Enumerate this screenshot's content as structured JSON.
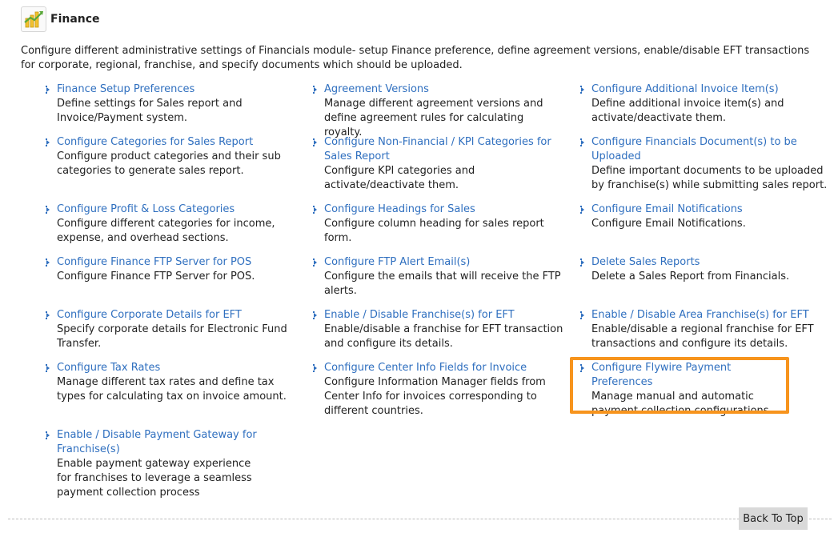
{
  "header": {
    "title": "Finance",
    "icon": "finance-chart-icon"
  },
  "intro": "Configure different administrative settings of Financials module- setup Finance preference, define agreement versions, enable/disable EFT transactions for corporate, regional, franchise, and specify documents which should be uploaded.",
  "items": [
    {
      "title": "Finance Setup Preferences",
      "desc": "Define settings for Sales report and Invoice/Payment system."
    },
    {
      "title": "Agreement Versions",
      "desc": "Manage different agreement versions and define agreement rules for calculating royalty."
    },
    {
      "title": "Configure Additional Invoice Item(s)",
      "desc": "Define additional invoice item(s) and activate/deactivate them."
    },
    {
      "title": "Configure Categories for Sales Report",
      "desc": "Configure product categories and their sub categories to generate sales report."
    },
    {
      "title": "Configure Non-Financial / KPI Categories for Sales Report",
      "desc": "Configure KPI categories and activate/deactivate them."
    },
    {
      "title": "Configure Financials Document(s) to be Uploaded",
      "desc": "Define important documents to be uploaded by franchise(s) while submitting sales report."
    },
    {
      "title": "Configure Profit & Loss Categories",
      "desc": "Configure different categories for income, expense, and overhead sections."
    },
    {
      "title": "Configure Headings for Sales",
      "desc": "Configure column heading for sales report form."
    },
    {
      "title": "Configure Email Notifications",
      "desc": "Configure Email Notifications."
    },
    {
      "title": "Configure Finance FTP Server for POS",
      "desc": "Configure Finance FTP Server for POS."
    },
    {
      "title": "Configure FTP Alert Email(s)",
      "desc": "Configure the emails that will receive the FTP alerts."
    },
    {
      "title": "Delete Sales Reports",
      "desc": "Delete a Sales Report from Financials."
    },
    {
      "title": "Configure Corporate Details for EFT",
      "desc": "Specify corporate details for Electronic Fund Transfer."
    },
    {
      "title": "Enable / Disable Franchise(s) for EFT",
      "desc": "Enable/disable a franchise for EFT transaction and configure its details."
    },
    {
      "title": "Enable / Disable Area Franchise(s) for EFT",
      "desc": "Enable/disable a regional franchise for EFT transactions and configure its details."
    },
    {
      "title": "Configure Tax Rates",
      "desc": "Manage different tax rates and define tax types for calculating tax on invoice amount."
    },
    {
      "title": "Configure Center Info Fields for Invoice",
      "desc": "Configure Information Manager fields from Center Info for invoices corresponding to different countries."
    },
    {
      "title": "Configure Flywire Payment Preferences",
      "desc": "Manage manual and automatic payment collection configurations."
    },
    {
      "title": "Enable / Disable Payment Gateway for Franchise(s)",
      "desc": "Enable payment gateway experience for franchises to leverage a seamless payment collection process"
    }
  ],
  "back_to_top": "Back To Top",
  "colors": {
    "link": "#2f6fbf",
    "highlight": "#f7941d",
    "button_bg": "#d9d9d9"
  }
}
